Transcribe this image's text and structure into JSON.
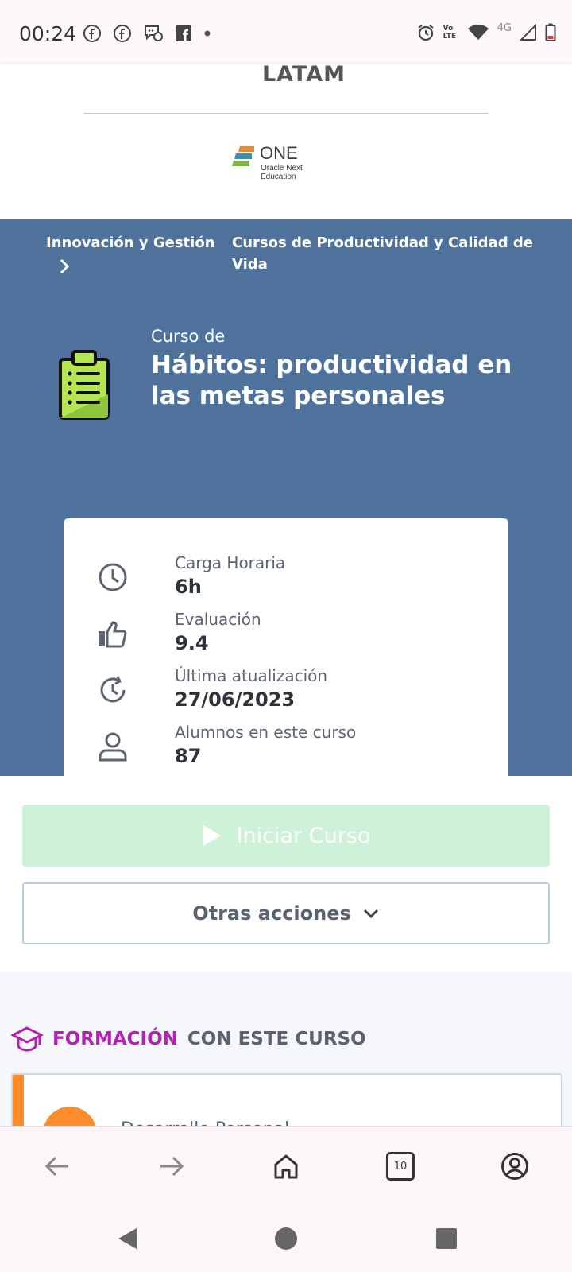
{
  "status_bar": {
    "time": "00:24",
    "network_label": "4G",
    "volte_label": "Vo LTE"
  },
  "header": {
    "region_label": "LATAM",
    "partner_logo": {
      "name": "ONE",
      "subtitle": "Oracle Next Education"
    }
  },
  "breadcrumb": {
    "items": [
      {
        "label": "Innovación y Gestión"
      },
      {
        "label": "Cursos de Productividad y Calidad de Vida"
      }
    ]
  },
  "course": {
    "prefix": "Curso de",
    "title": "Hábitos: productividad en las metas personales",
    "icon": "clipboard-icon"
  },
  "stats": [
    {
      "label": "Carga Horaria",
      "value": "6h",
      "icon": "clock-icon"
    },
    {
      "label": "Evaluación",
      "value": "9.4",
      "icon": "thumbs-up-icon"
    },
    {
      "label": "Última atualización",
      "value": "27/06/2023",
      "icon": "history-icon"
    },
    {
      "label": "Alumnos en este curso",
      "value": "87",
      "icon": "user-icon"
    }
  ],
  "actions": {
    "start_label": "Iniciar Curso",
    "other_label": "Otras acciones"
  },
  "formacion": {
    "title_highlight": "FORMACIÓN",
    "title_rest": "CON ESTE CURSO",
    "card_text": "Desarrollo Personal"
  },
  "browser_nav": {
    "tab_count": "10"
  },
  "colors": {
    "hero_bg": "#4e729c",
    "start_button_bg": "#cdf2d7",
    "formacion_accent": "#b41fb4",
    "card_accent": "#ff8c2a"
  }
}
